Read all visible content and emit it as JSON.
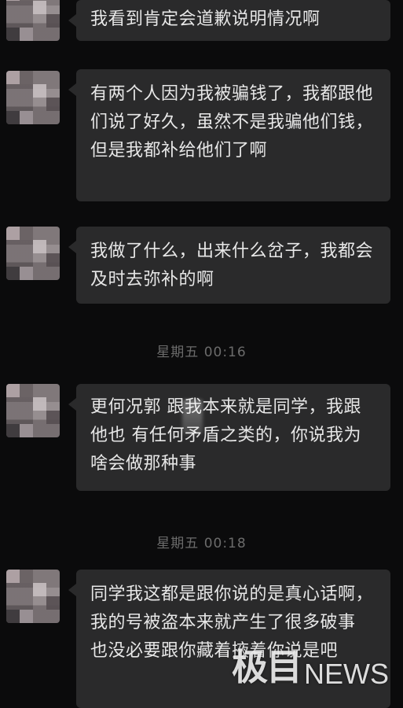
{
  "messages": [
    {
      "text": "我看到肯定会道歉说明情况啊"
    },
    {
      "text": "有两个人因为我被骗钱了，我都跟他们说了好久，虽然不是我骗他们钱，但是我都补给他们了啊"
    },
    {
      "text": "我做了什么，出来什么岔子，我都会及时去弥补的啊"
    },
    {
      "text": "更何况郭 跟我本来就是同学，我跟他也 有任何矛盾之类的，你说我为啥会做那种事"
    },
    {
      "text": "同学我这都是跟你说的是真心话啊，我的号被盗本来就产生了很多破事 也没必要跟你藏着掖着你说是吧"
    }
  ],
  "timestamps": [
    {
      "label": "星期五 00:16"
    },
    {
      "label": "星期五 00:18"
    }
  ],
  "watermark": {
    "cn": "极目",
    "en": "NEWS"
  }
}
